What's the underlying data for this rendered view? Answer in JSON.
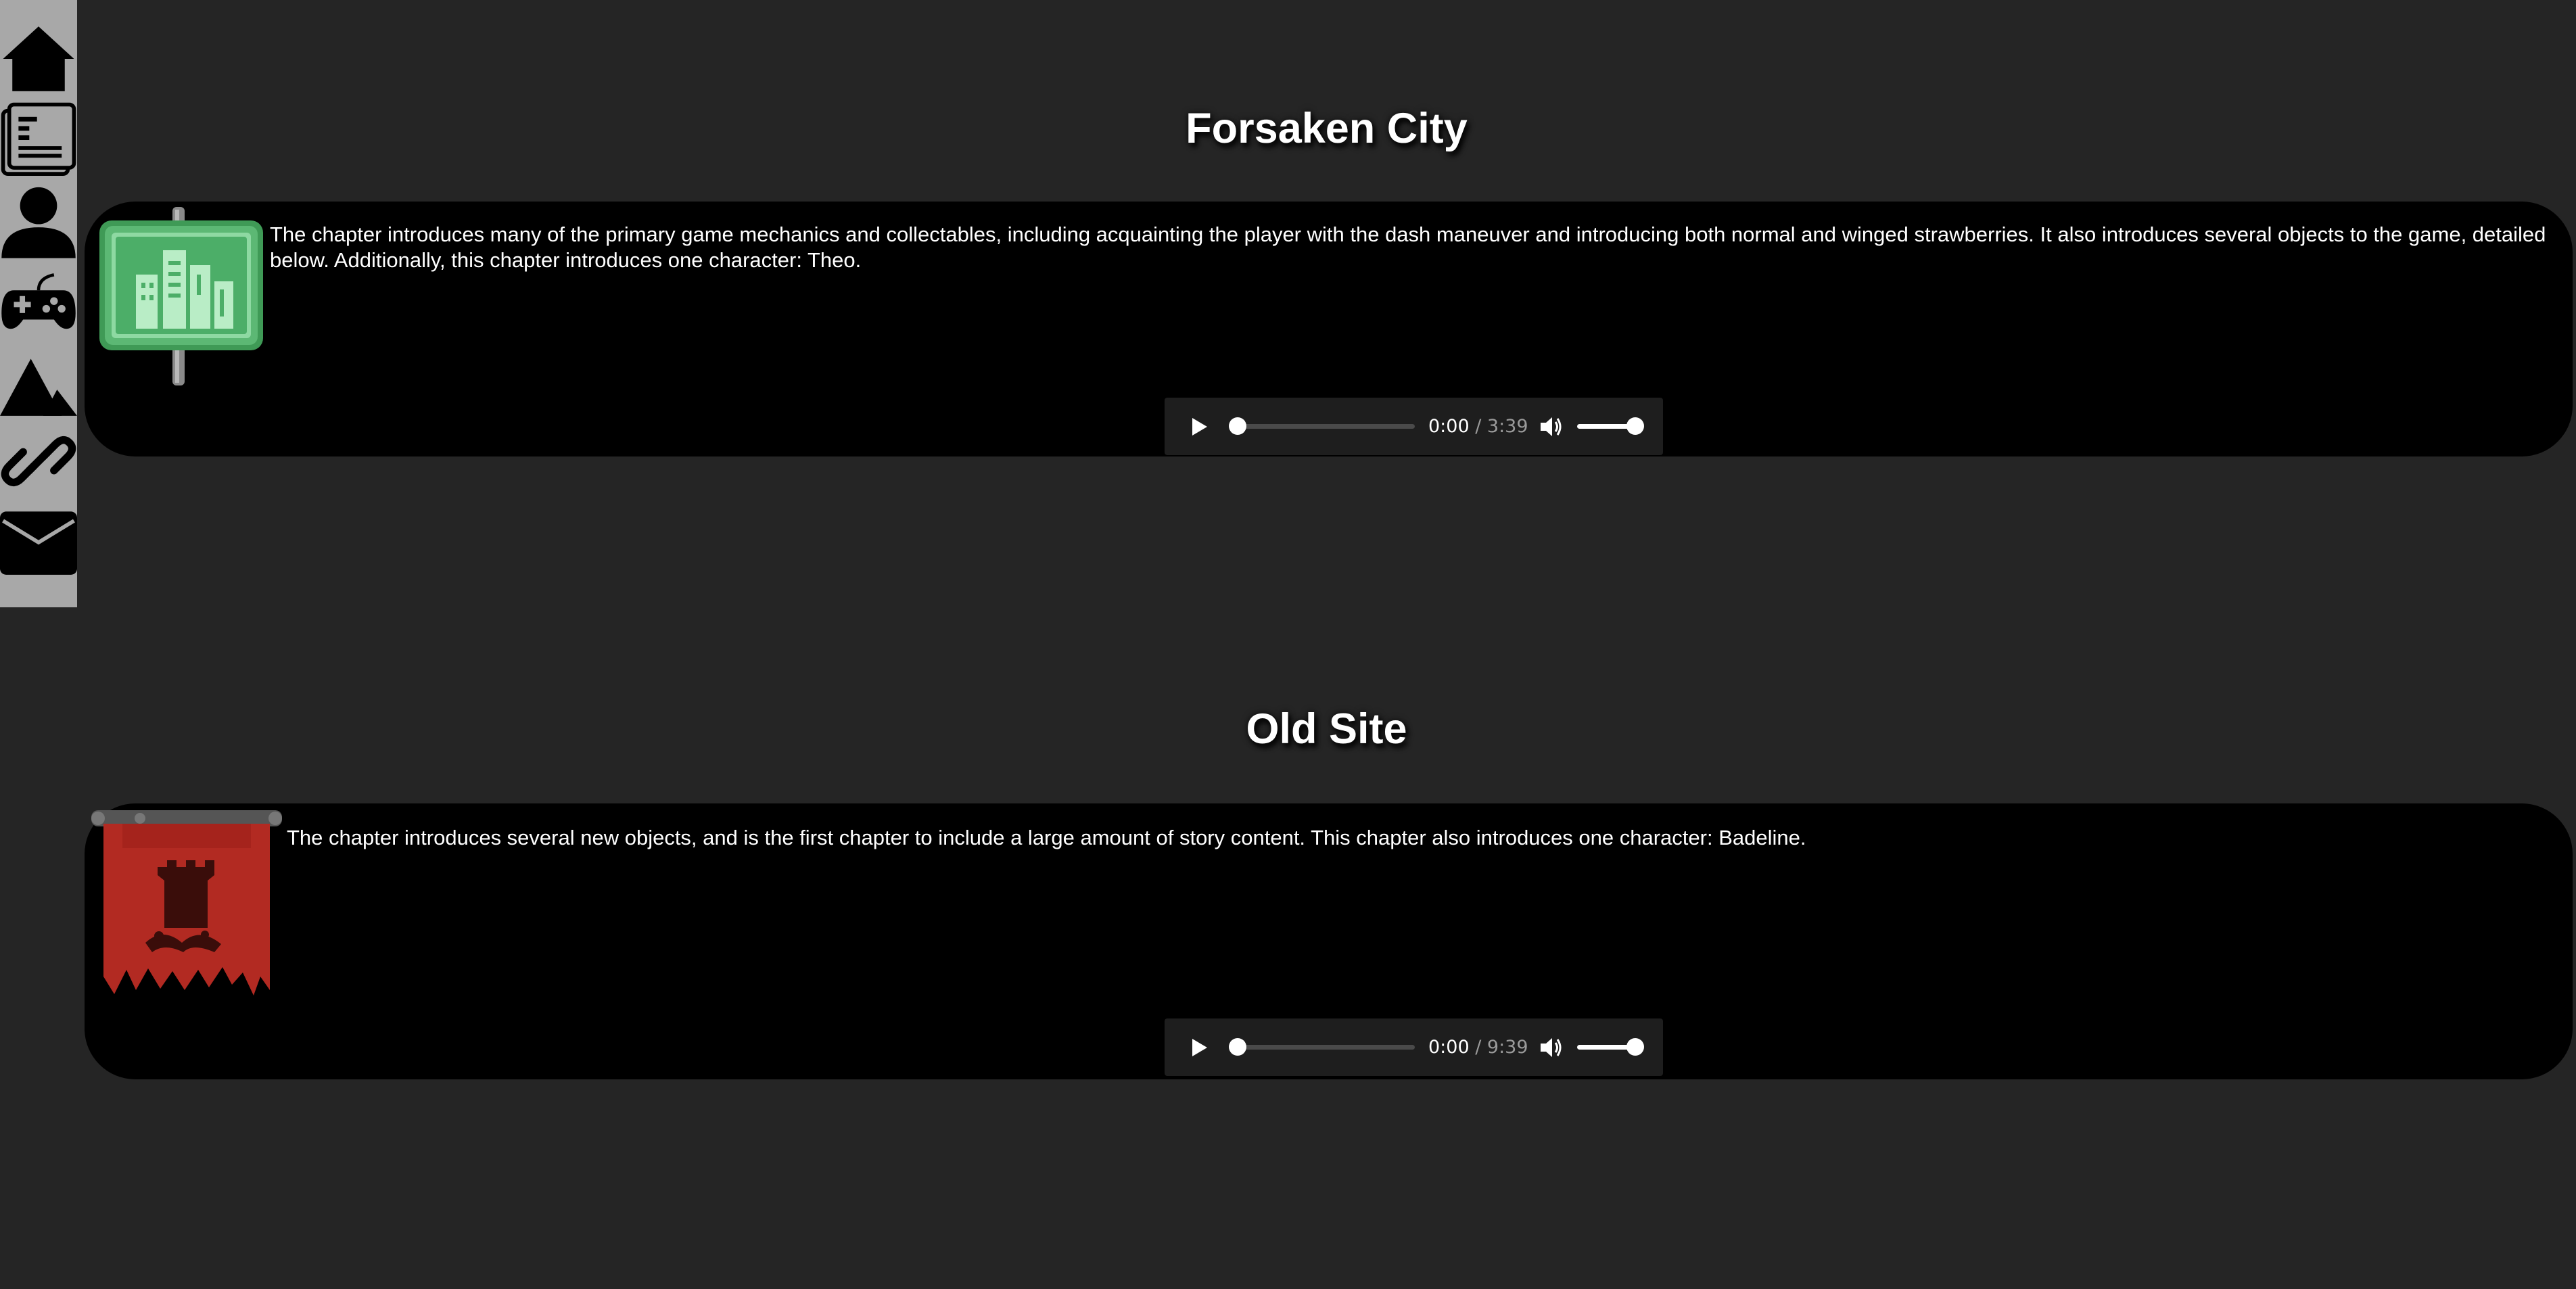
{
  "sidebar": {
    "items": [
      {
        "icon": "home-icon"
      },
      {
        "icon": "newspaper-icon"
      },
      {
        "icon": "user-icon"
      },
      {
        "icon": "gamepad-icon"
      },
      {
        "icon": "mountain-icon"
      },
      {
        "icon": "link-icon"
      },
      {
        "icon": "mail-icon"
      }
    ]
  },
  "chapters": [
    {
      "title": "Forsaken City",
      "image_icon": "city-signpost-icon",
      "description": "The chapter introduces many of the primary game mechanics and collectables, including acquainting the player with the dash maneuver and introducing both normal and winged strawberries. It also introduces several objects to the game, detailed below. Additionally, this chapter introduces one character: Theo.",
      "audio": {
        "current": "0:00",
        "separator": " / ",
        "duration": "3:39",
        "progress": 0,
        "volume": 1.0
      }
    },
    {
      "title": "Old Site",
      "image_icon": "tattered-red-banner-icon",
      "description": "The chapter introduces several new objects, and is the first chapter to include a large amount of story content. This chapter also introduces one character: Badeline.",
      "audio": {
        "current": "0:00",
        "separator": " / ",
        "duration": "9:39",
        "progress": 0,
        "volume": 1.0
      }
    }
  ],
  "colors": {
    "page_bg": "#252525",
    "sidebar_bg": "#a8a8a8",
    "card_bg": "#000000",
    "sign_green": "#5cb874",
    "banner_red": "#b22a22"
  }
}
